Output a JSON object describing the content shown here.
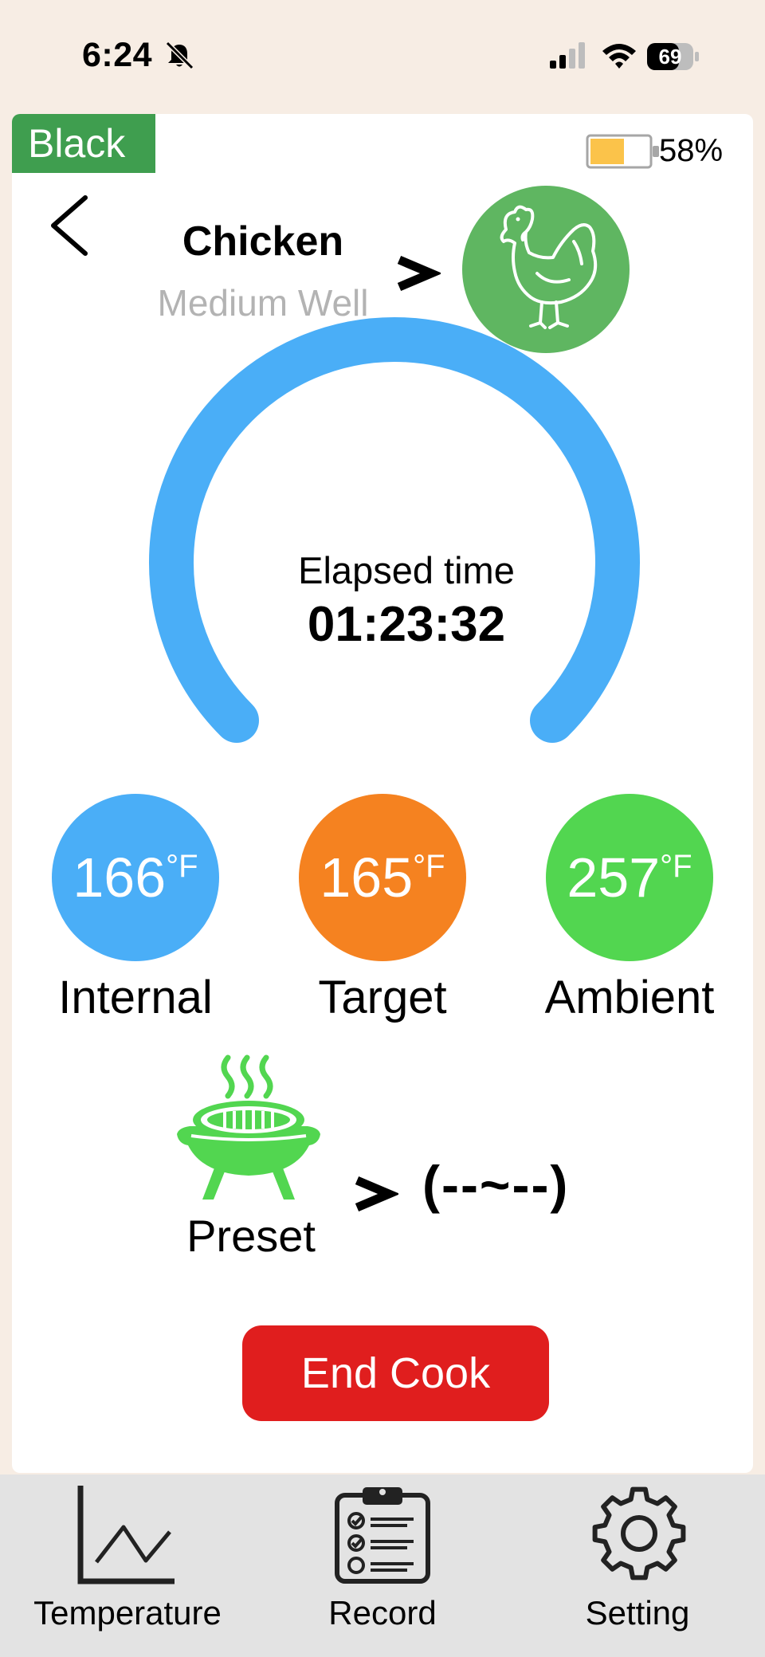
{
  "status_bar": {
    "time": "6:24",
    "battery": "69"
  },
  "device": {
    "name": "Black",
    "battery_level": 0.58,
    "battery_text": "58%",
    "tag_color": "#3f9e4f",
    "battery_color": "#fbc34a"
  },
  "food": {
    "name": "Chicken",
    "doneness": "Medium Well",
    "arrow": ">",
    "icon": "chicken-icon",
    "circle_color": "#5fb661"
  },
  "timer": {
    "label": "Elapsed time",
    "value": "01:23:32",
    "ring_color": "#4aaef7"
  },
  "temps": [
    {
      "value": "166",
      "unit": "°F",
      "label": "Internal",
      "color": "#4aaef7"
    },
    {
      "value": "165",
      "unit": "°F",
      "label": "Target",
      "color": "#f58220"
    },
    {
      "value": "257",
      "unit": "°F",
      "label": "Ambient",
      "color": "#52d650"
    }
  ],
  "preset": {
    "label": "Preset",
    "arrow": ">",
    "value": "(--~--)",
    "icon": "grill-icon",
    "icon_color": "#52d650"
  },
  "actions": {
    "end_cook": "End Cook",
    "end_cook_color": "#e01e1e"
  },
  "tabs": [
    {
      "label": "Temperature",
      "icon": "line-chart-icon"
    },
    {
      "label": "Record",
      "icon": "clipboard-checklist-icon"
    },
    {
      "label": "Setting",
      "icon": "gear-icon"
    }
  ]
}
